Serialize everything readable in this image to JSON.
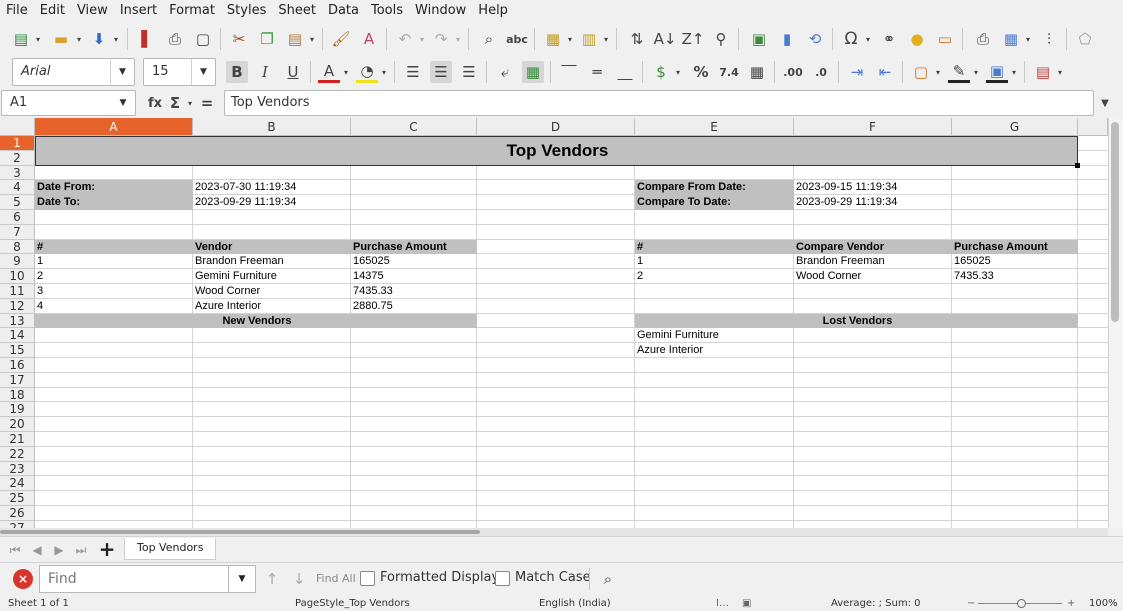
{
  "menu": [
    "File",
    "Edit",
    "View",
    "Insert",
    "Format",
    "Styles",
    "Sheet",
    "Data",
    "Tools",
    "Window",
    "Help"
  ],
  "format_bar": {
    "font_name": "Arial",
    "font_size": "15"
  },
  "formula_bar": {
    "name_box": "A1",
    "content": "Top Vendors"
  },
  "columns": [
    "A",
    "B",
    "C",
    "D",
    "E",
    "F",
    "G"
  ],
  "rows": [
    "1",
    "2",
    "3",
    "4",
    "5",
    "6",
    "7",
    "8",
    "9",
    "10",
    "11",
    "12",
    "13",
    "14",
    "15",
    "16",
    "17",
    "18",
    "19",
    "20",
    "21",
    "22",
    "23",
    "24",
    "25",
    "26",
    "27"
  ],
  "sheet": {
    "title": "Top Vendors",
    "date_from_label": "Date From:",
    "date_from": "2023-07-30 11:19:34",
    "date_to_label": "Date To:",
    "date_to": "2023-09-29 11:19:34",
    "compare_from_label": "Compare From Date:",
    "compare_from": "2023-09-15 11:19:34",
    "compare_to_label": "Compare To Date:",
    "compare_to": "2023-09-29 11:19:34",
    "left_headers": [
      "#",
      "Vendor",
      "Purchase Amount"
    ],
    "left_rows": [
      [
        "1",
        "Brandon Freeman",
        "165025"
      ],
      [
        "2",
        "Gemini Furniture",
        "14375"
      ],
      [
        "3",
        "Wood Corner",
        "7435.33"
      ],
      [
        "4",
        "Azure Interior",
        "2880.75"
      ]
    ],
    "right_headers": [
      "#",
      "Compare Vendor",
      "Purchase Amount"
    ],
    "right_rows": [
      [
        "1",
        "Brandon Freeman",
        "165025"
      ],
      [
        "2",
        "Wood Corner",
        "7435.33"
      ]
    ],
    "new_vendors_label": "New Vendors",
    "lost_vendors_label": "Lost Vendors",
    "lost_vendors": [
      "Gemini Furniture",
      "Azure Interior"
    ]
  },
  "tabs": {
    "active": "Top Vendors"
  },
  "find_bar": {
    "placeholder": "Find",
    "find_all": "Find All",
    "formatted_display": "Formatted Display",
    "match_case": "Match Case"
  },
  "status_bar": {
    "sheet": "Sheet 1 of 1",
    "page_style": "PageStyle_Top Vendors",
    "language": "English (India)",
    "summary": "Average: ; Sum: 0",
    "zoom": "100%"
  },
  "colors": {
    "selection_header": "#e8632b",
    "cell_fill_gray": "#c0c0c0",
    "close_red": "#d9342b"
  }
}
